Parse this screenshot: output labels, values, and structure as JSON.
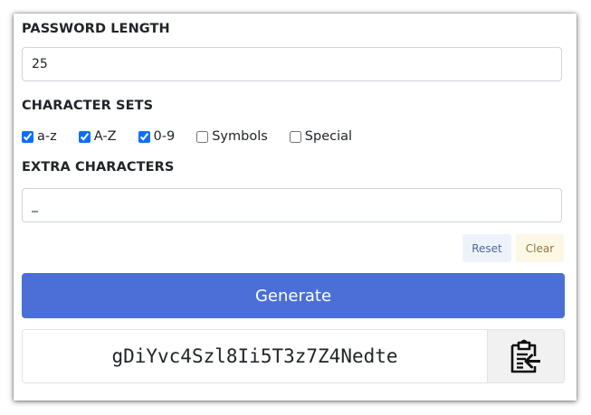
{
  "password_length": {
    "label": "PASSWORD LENGTH",
    "value": "25"
  },
  "character_sets": {
    "label": "CHARACTER SETS",
    "options": [
      {
        "label": "a-z",
        "checked": true
      },
      {
        "label": "A-Z",
        "checked": true
      },
      {
        "label": "0-9",
        "checked": true
      },
      {
        "label": "Symbols",
        "checked": false
      },
      {
        "label": "Special",
        "checked": false
      }
    ]
  },
  "extra_characters": {
    "label": "EXTRA CHARACTERS",
    "value": "_"
  },
  "buttons": {
    "reset_label": "Reset",
    "clear_label": "Clear",
    "generate_label": "Generate"
  },
  "output": {
    "password": "gDiYvc4Szl8Ii5T3z7Z4Nedte",
    "copy_icon": "clipboard-copy-icon"
  },
  "colors": {
    "primary": "#4b6fd6",
    "reset_bg": "#eef3fb",
    "clear_bg": "#fdf8e6",
    "checkbox_accent": "#0d6efd"
  }
}
